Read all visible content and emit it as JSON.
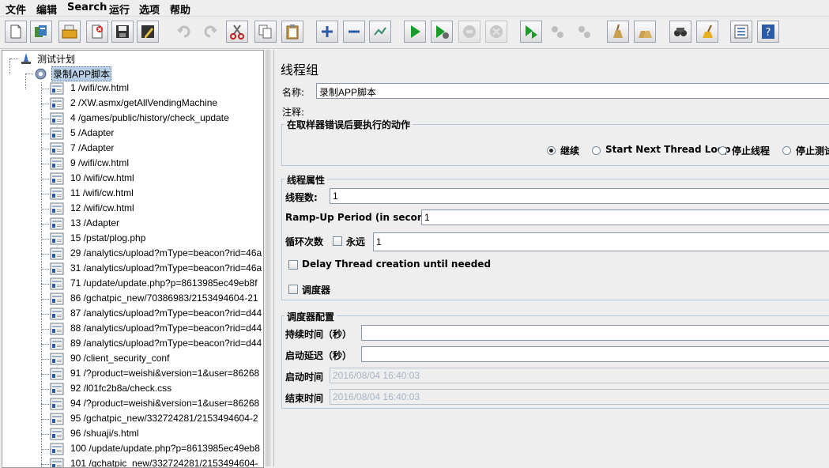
{
  "menu": {
    "file": "文件",
    "edit": "编辑",
    "search": "Search",
    "run": "运行",
    "options": "选项",
    "help": "帮助"
  },
  "toolbar": {
    "buttons": [
      "new-icon",
      "templates-icon",
      "open-icon",
      "close-icon",
      "save-icon",
      "save-as-icon",
      "undo-icon",
      "redo-icon",
      "cut-icon",
      "copy-icon",
      "paste-icon",
      "expand-icon",
      "collapse-icon",
      "toggle-icon",
      "start-icon",
      "start-no-pause-icon",
      "stop-icon",
      "shutdown-icon",
      "remote-start-icon",
      "remote-stop-icon",
      "remote-shutdown-icon",
      "clear-icon",
      "clear-all-icon",
      "search-icon",
      "reset-search-icon",
      "function-helper-icon",
      "help-icon"
    ]
  },
  "tree": {
    "root": "测试计划",
    "thread_group": "录制APP脚本",
    "samplers": [
      "1 /wifi/cw.html",
      "2 /XW.asmx/getAllVendingMachine",
      "4 /games/public/history/check_update",
      "5 /Adapter",
      "7 /Adapter",
      "9 /wifi/cw.html",
      "10 /wifi/cw.html",
      "11 /wifi/cw.html",
      "12 /wifi/cw.html",
      "13 /Adapter",
      "15 /pstat/plog.php",
      "29 /analytics/upload?mType=beacon?rid=46a",
      "31 /analytics/upload?mType=beacon?rid=46a",
      "71 /update/update.php?p=8613985ec49eb8f",
      "86 /gchatpic_new/70386983/2153494604-21",
      "87 /analytics/upload?mType=beacon?rid=d44",
      "88 /analytics/upload?mType=beacon?rid=d44",
      "89 /analytics/upload?mType=beacon?rid=d44",
      "90 /client_security_conf",
      "91 /?product=weishi&version=1&user=86268",
      "92 /l01fc2b8a/check.css",
      "94 /?product=weishi&version=1&user=86268",
      "95 /gchatpic_new/332724281/2153494604-2",
      "96 /shuaji/s.html",
      "100 /update/update.php?p=8613985ec49eb8",
      "101 /gchatpic_new/332724281/2153494604-"
    ]
  },
  "panel": {
    "title": "线程组",
    "name_label": "名称:",
    "name_value": "录制APP脚本",
    "comment_label": "注释:",
    "comment_value": "",
    "error_group_title": "在取样器错误后要执行的动作",
    "error_options": [
      "继续",
      "Start Next Thread Loop",
      "停止线程",
      "停止测试"
    ],
    "error_selected": 0,
    "thread_group_title": "线程属性",
    "threads_label": "线程数:",
    "threads_value": "1",
    "rampup_label": "Ramp-Up Period (in seconds):",
    "rampup_value": "1",
    "loop_label": "循环次数",
    "forever_label": "永远",
    "loop_value": "1",
    "delay_label": "Delay Thread creation until needed",
    "scheduler_label": "调度器",
    "scheduler_group_title": "调度器配置",
    "duration_label": "持续时间（秒）",
    "duration_value": "",
    "startup_delay_label": "启动延迟（秒）",
    "startup_delay_value": "",
    "start_time_label": "启动时间",
    "start_time_value": "2016/08/04 16:40:03",
    "end_time_label": "结束时间",
    "end_time_value": "2016/08/04 16:40:03"
  },
  "colors": {
    "selection": "#b8cfe5",
    "accent_green": "#1a9a2a",
    "accent_blue": "#2a5aa8",
    "cut_red": "#c42020"
  }
}
